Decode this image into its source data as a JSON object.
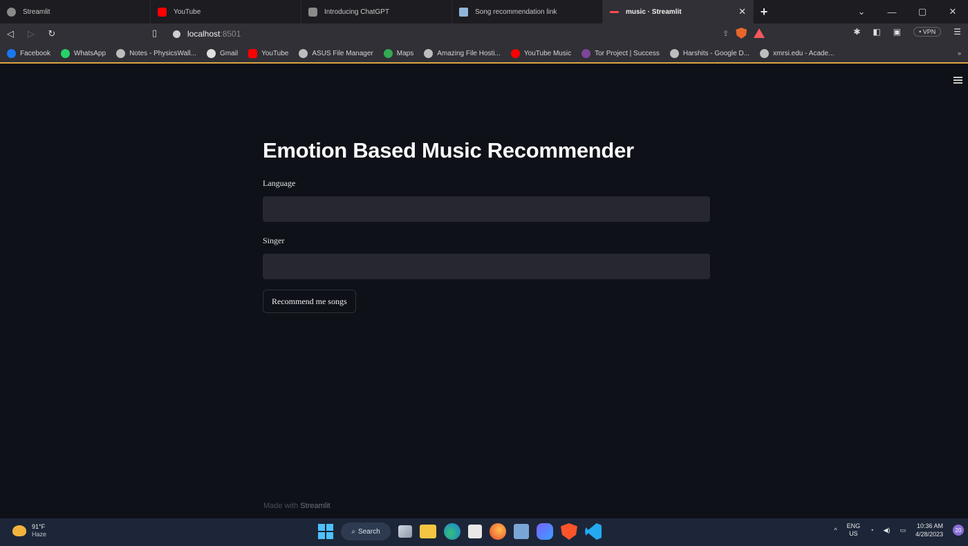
{
  "browser": {
    "tabs": [
      {
        "title": "Streamlit",
        "icon_color": "#8a8a8a",
        "active": false
      },
      {
        "title": "YouTube",
        "icon_color": "#ff0000",
        "active": false
      },
      {
        "title": "Introducing ChatGPT",
        "icon_color": "#8a8a8a",
        "active": false
      },
      {
        "title": "Song recommendation link",
        "icon_color": "#8fb6d9",
        "active": false
      },
      {
        "title": "music · Streamlit",
        "icon_color": "#ff4b4b",
        "active": true
      }
    ],
    "new_tab": "+",
    "window_controls": {
      "chevron": "⌄",
      "minimize": "—",
      "maximize": "▢",
      "close": "✕"
    },
    "nav": {
      "back": "◁",
      "forward": "▷",
      "reload": "↻"
    },
    "url": {
      "host": "localhost",
      "port": ":8501"
    },
    "vpn_label": "• VPN",
    "bookmarks": [
      {
        "label": "Facebook",
        "icon_color": "#1877f2"
      },
      {
        "label": "WhatsApp",
        "icon_color": "#25d366"
      },
      {
        "label": "Notes - PhysicsWall...",
        "icon_color": "#bdbdbd"
      },
      {
        "label": "Gmail",
        "icon_color": "#e0e0e0"
      },
      {
        "label": "YouTube",
        "icon_color": "#ff0000"
      },
      {
        "label": "ASUS File Manager",
        "icon_color": "#bdbdbd"
      },
      {
        "label": "Maps",
        "icon_color": "#34a853"
      },
      {
        "label": "Amazing File Hosti...",
        "icon_color": "#bdbdbd"
      },
      {
        "label": "YouTube Music",
        "icon_color": "#ff0000"
      },
      {
        "label": "Tor Project | Success",
        "icon_color": "#7d4698"
      },
      {
        "label": "Harshits - Google D...",
        "icon_color": "#bdbdbd"
      },
      {
        "label": "xmrsi.edu - Acade...",
        "icon_color": "#bdbdbd"
      }
    ],
    "bookmarks_more": "»"
  },
  "app": {
    "title": "Emotion Based Music Recommender",
    "language_label": "Language",
    "language_value": "",
    "singer_label": "Singer",
    "singer_value": "",
    "button_label": "Recommend me songs",
    "footer_prefix": "Made with ",
    "footer_brand": "Streamlit"
  },
  "taskbar": {
    "weather_temp": "91°F",
    "weather_desc": "Haze",
    "search_label": "Search",
    "lang_top": "ENG",
    "lang_bottom": "US",
    "time": "10:36 AM",
    "date": "4/28/2023",
    "notification_count": "20"
  }
}
